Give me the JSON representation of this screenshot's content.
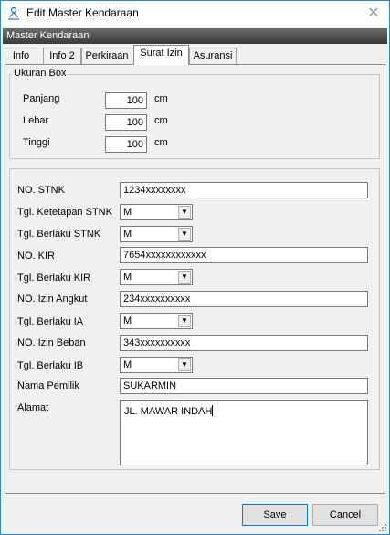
{
  "window": {
    "title": "Edit Master Kendaraan",
    "close_glyph": "✕"
  },
  "header": {
    "title": "Master Kendaraan"
  },
  "tabs": [
    {
      "label": "Info",
      "active": false
    },
    {
      "label": "Info 2",
      "active": false
    },
    {
      "label": "Perkiraan",
      "active": false
    },
    {
      "label": "Surat Izin",
      "active": true
    },
    {
      "label": "Asuransi",
      "active": false
    }
  ],
  "box": {
    "title": "Ukuran Box",
    "panjang": {
      "label": "Panjang",
      "value": "100",
      "unit": "cm"
    },
    "lebar": {
      "label": "Lebar",
      "value": "100",
      "unit": "cm"
    },
    "tinggi": {
      "label": "Tinggi",
      "value": "100",
      "unit": "cm"
    }
  },
  "form": {
    "no_stnk": {
      "label": "NO. STNK",
      "value": "1234xxxxxxxx"
    },
    "tgl_ketetapan_stnk": {
      "label": "Tgl. Ketetapan STNK",
      "value": "M"
    },
    "tgl_berlaku_stnk": {
      "label": "Tgl. Berlaku STNK",
      "value": "M"
    },
    "no_kir": {
      "label": "NO. KIR",
      "value": "7654xxxxxxxxxxxx"
    },
    "tgl_berlaku_kir": {
      "label": "Tgl. Berlaku KIR",
      "value": "M"
    },
    "no_izin_angkut": {
      "label": "NO. Izin Angkut",
      "value": "234xxxxxxxxxx"
    },
    "tgl_berlaku_ia": {
      "label": "Tgl. Berlaku IA",
      "value": "M"
    },
    "no_izin_beban": {
      "label": "NO. Izin Beban",
      "value": "343xxxxxxxxxx"
    },
    "tgl_berlaku_ib": {
      "label": "Tgl. Berlaku IB",
      "value": "M"
    },
    "nama_pemilik": {
      "label": "Nama Pemilik",
      "value": "SUKARMIN"
    },
    "alamat": {
      "label": "Alamat",
      "value": "JL. MAWAR INDAH"
    }
  },
  "buttons": {
    "save": {
      "label_underlined": "S",
      "label_rest": "ave"
    },
    "cancel": {
      "label_underlined": "C",
      "label_rest": "ancel"
    }
  }
}
